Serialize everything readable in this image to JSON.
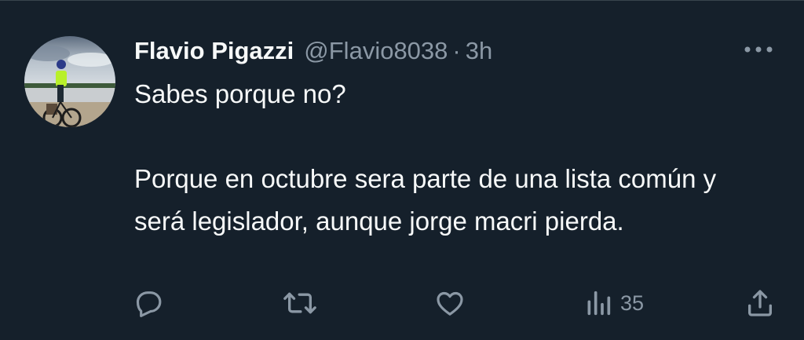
{
  "tweet": {
    "author_name": "Flavio Pigazzi",
    "handle": "@Flavio8038",
    "separator": "·",
    "time": "3h",
    "text_line1": "Sabes porque no?",
    "text_line2": "Porque en octubre sera parte de una lista común y será legislador, aunque jorge macri pierda.",
    "views_count": "35"
  },
  "icons": {
    "reply": "reply-icon",
    "retweet": "retweet-icon",
    "like": "like-icon",
    "views": "views-icon",
    "share": "share-icon",
    "more": "more-icon"
  },
  "colors": {
    "background": "#15202b",
    "text_primary": "#f7f9f9",
    "text_secondary": "#8b98a5"
  }
}
